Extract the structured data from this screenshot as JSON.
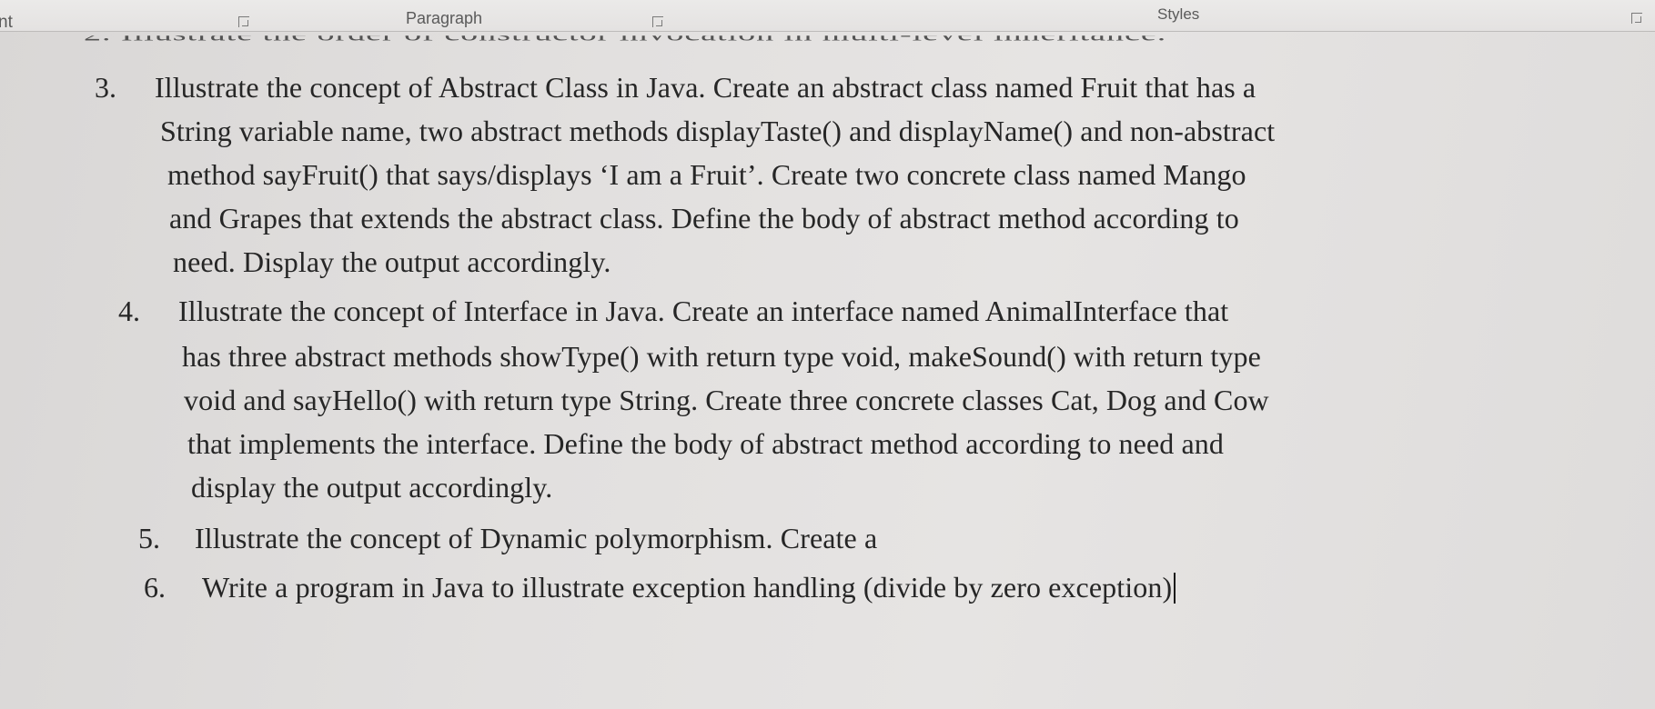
{
  "ribbon": {
    "font_group_label": "nt",
    "paragraph_group_label": "Paragraph",
    "styles_group_label": "Styles"
  },
  "document": {
    "partial_top_line": "2. Illustrate the order of constructor invocation in multi-level inheritance.",
    "items": [
      {
        "number": "3.",
        "lines": [
          "Illustrate the concept of Abstract Class in Java. Create an abstract class named Fruit that has a",
          "String variable name, two abstract methods displayTaste() and displayName() and non-abstract",
          "method sayFruit() that says/displays ‘I am a Fruit’. Create two concrete class named Mango",
          "and Grapes that extends the abstract class. Define the body of abstract method according to",
          "need. Display the output accordingly."
        ]
      },
      {
        "number": "4.",
        "lines": [
          "Illustrate the concept of Interface in Java. Create an interface named AnimalInterface  that",
          "has three abstract methods showType() with return type void, makeSound() with return type",
          "void and sayHello() with return type String. Create three concrete classes Cat, Dog and Cow",
          "that implements the interface. Define the body of abstract method according to need and",
          "display the output accordingly."
        ]
      },
      {
        "number": "5.",
        "lines": [
          "Illustrate the concept of Dynamic polymorphism. Create a"
        ]
      },
      {
        "number": "6.",
        "lines": [
          "Write a program in Java to illustrate exception handling (divide by zero exception)"
        ]
      }
    ]
  }
}
